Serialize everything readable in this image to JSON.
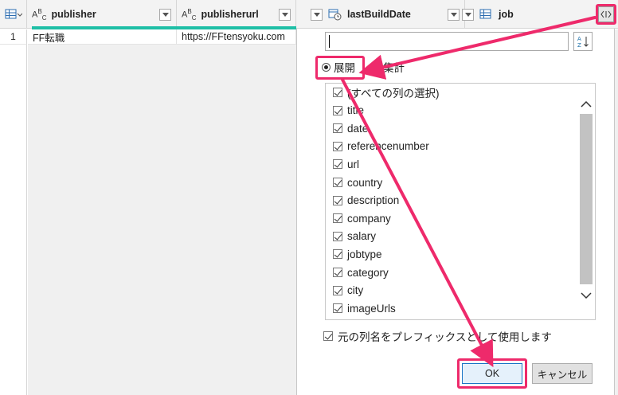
{
  "columns": [
    {
      "type_icon": "ABC",
      "name": "publisher"
    },
    {
      "type_icon": "ABC",
      "name": "publisherurl"
    },
    {
      "type_icon": "calendar-clock",
      "name": "lastBuildDate"
    },
    {
      "type_icon": "table",
      "name": "job"
    }
  ],
  "rows": [
    {
      "num": "1",
      "publisher": "FF転職",
      "publisherurl": "https://FFtensyoku.com"
    }
  ],
  "popup": {
    "search_value": "",
    "radio_expand": "展開",
    "radio_aggregate": "集計",
    "items": [
      {
        "label": "(すべての列の選択)",
        "checked": true
      },
      {
        "label": "title",
        "checked": true
      },
      {
        "label": "date",
        "checked": true
      },
      {
        "label": "referencenumber",
        "checked": true
      },
      {
        "label": "url",
        "checked": true
      },
      {
        "label": "country",
        "checked": true
      },
      {
        "label": "description",
        "checked": true
      },
      {
        "label": "company",
        "checked": true
      },
      {
        "label": "salary",
        "checked": true
      },
      {
        "label": "jobtype",
        "checked": true
      },
      {
        "label": "category",
        "checked": true
      },
      {
        "label": "city",
        "checked": true
      },
      {
        "label": "imageUrls",
        "checked": true
      }
    ],
    "prefix_label": "元の列名をプレフィックスとして使用します",
    "ok_label": "OK",
    "cancel_label": "キャンセル"
  },
  "colors": {
    "annotation": "#ee2a6b",
    "accent": "#1fbfa6"
  }
}
